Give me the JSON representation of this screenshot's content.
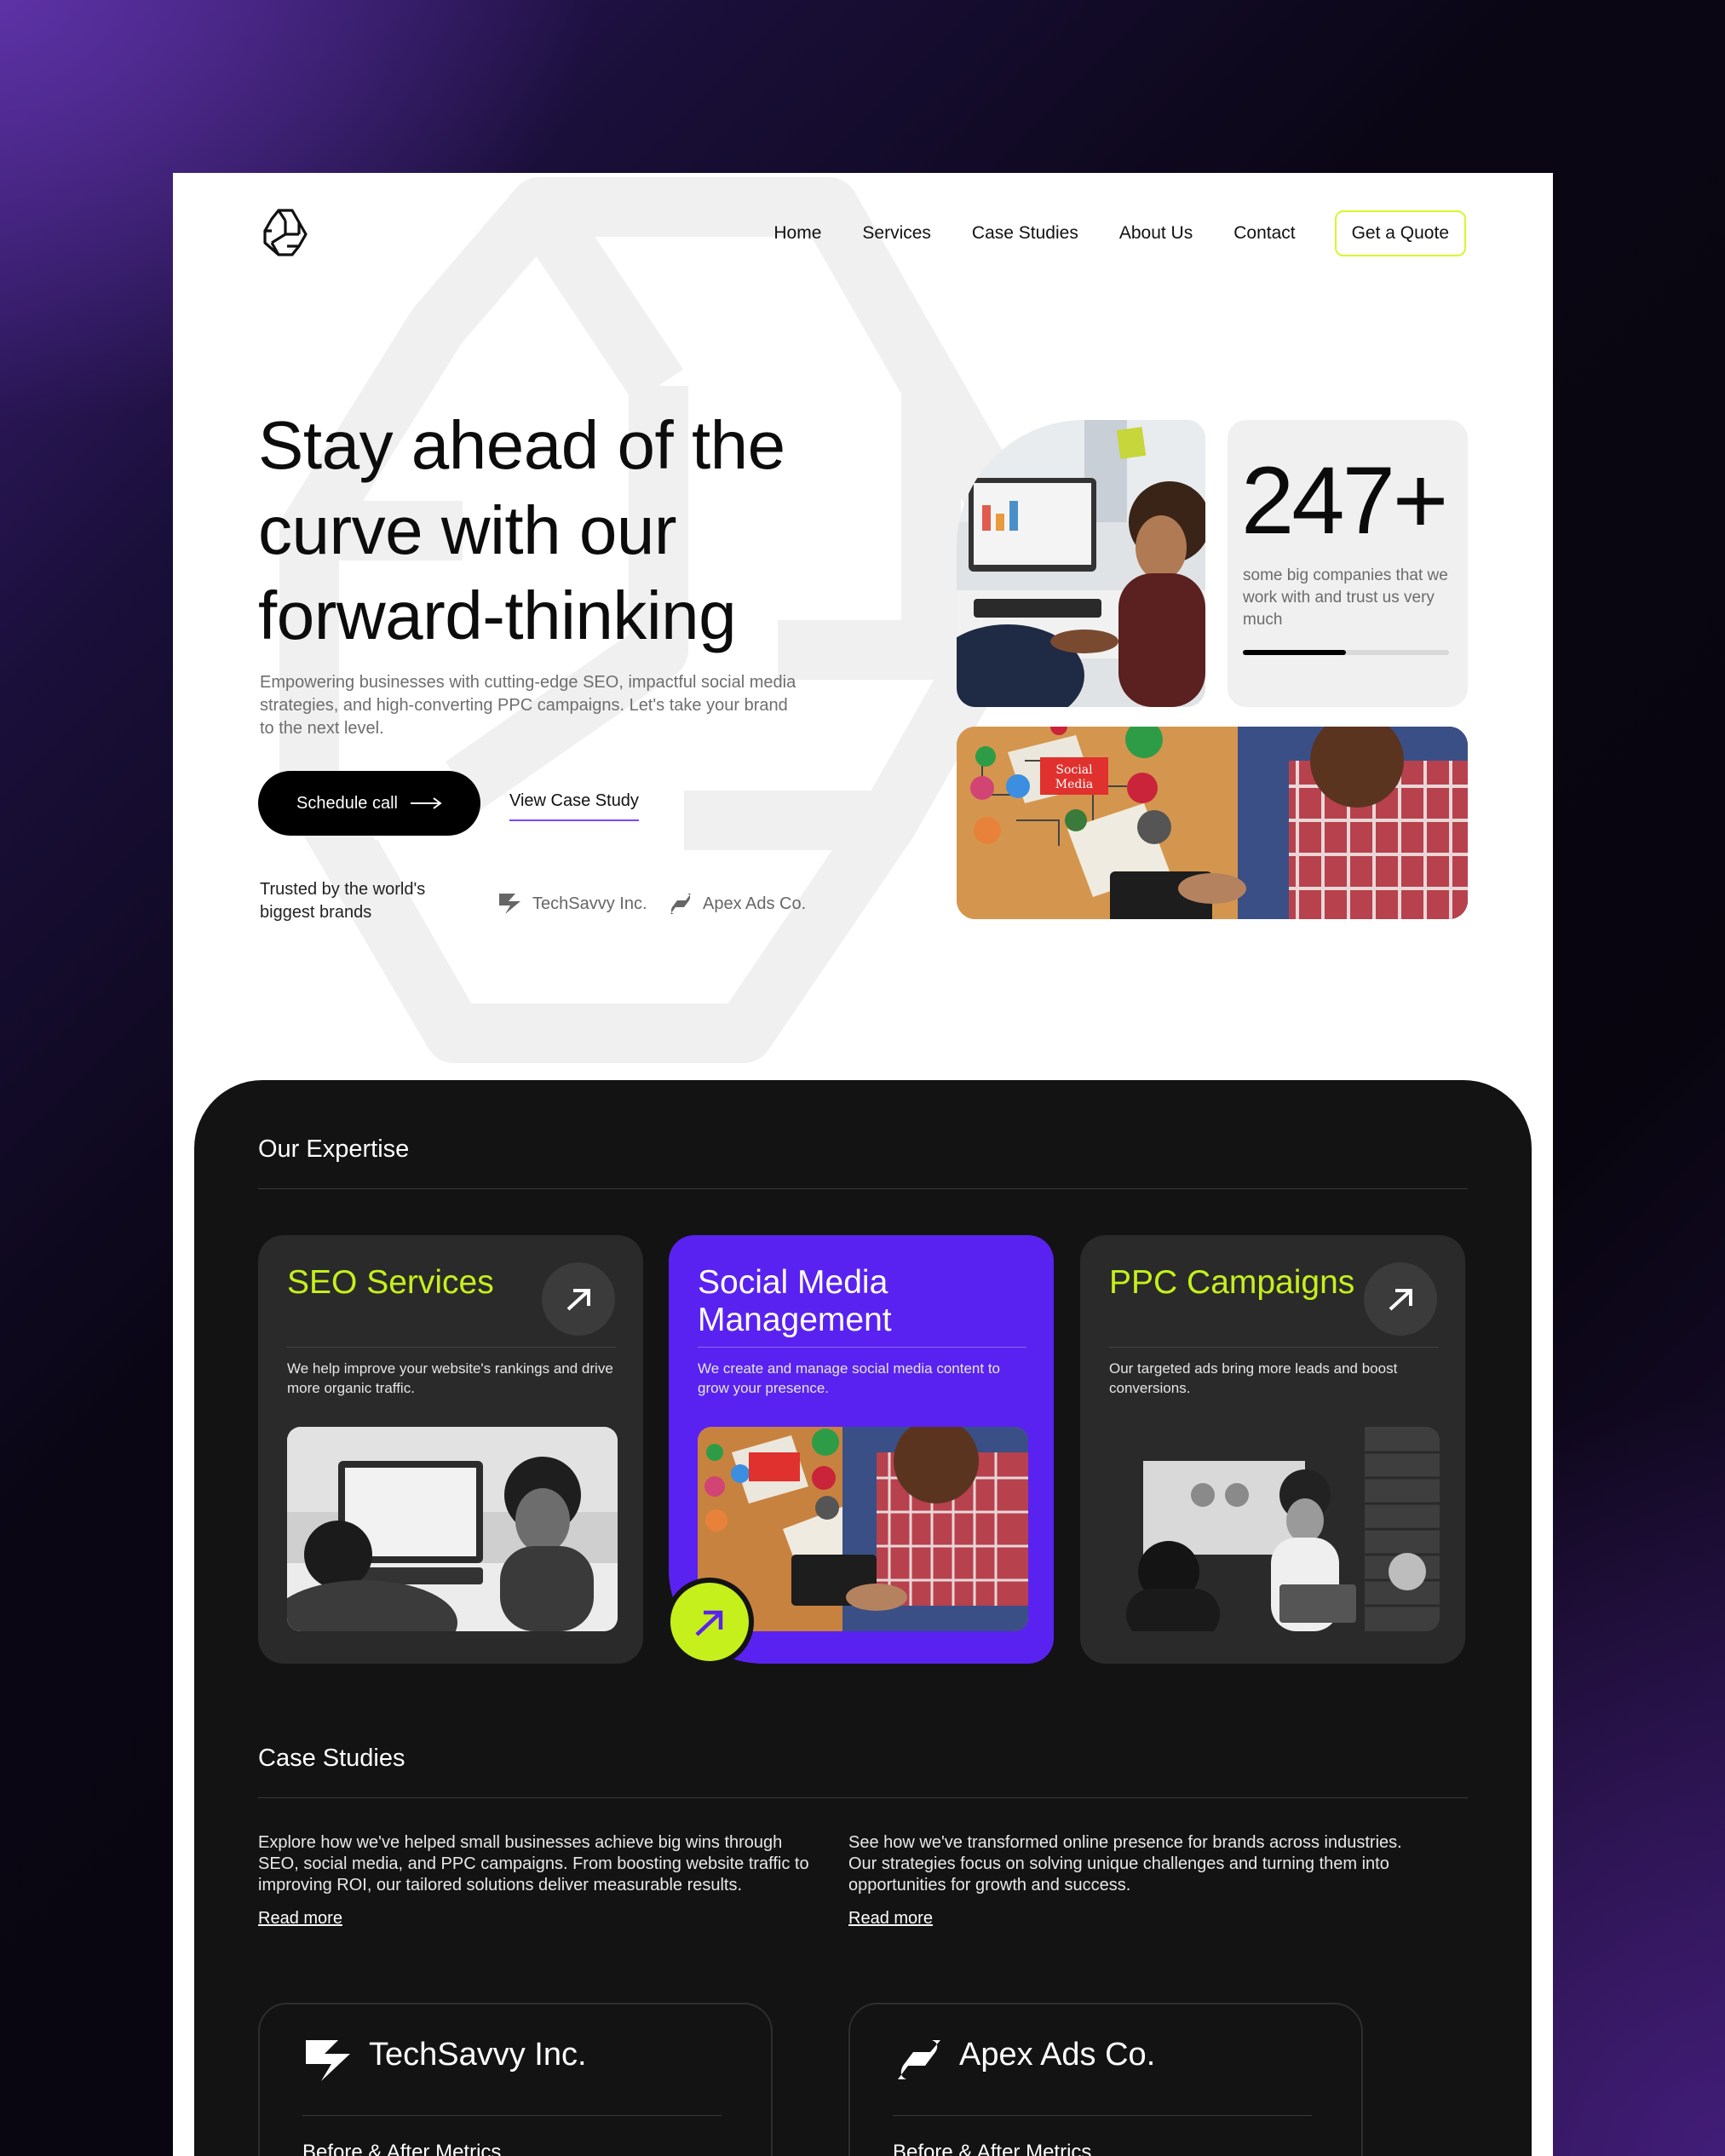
{
  "nav": {
    "items": [
      "Home",
      "Services",
      "Case Studies",
      "About Us",
      "Contact"
    ],
    "cta": "Get a Quote"
  },
  "hero": {
    "title": "Stay ahead of the curve with our forward-thinking",
    "subtitle": "Empowering businesses with cutting-edge SEO, impactful social media strategies, and high-converting PPC campaigns. Let's take your brand to the next level.",
    "primary_button": "Schedule call",
    "secondary_button": "View Case Study",
    "trusted_text": "Trusted by the world's biggest brands",
    "brands": [
      "TechSavvy Inc.",
      "Apex Ads Co."
    ],
    "stat_value": "247+",
    "stat_text": "some big companies that we work with and trust us very much",
    "stat_progress": 0.5,
    "social_tag": "Social Media"
  },
  "expertise": {
    "heading": "Our Expertise",
    "cards": [
      {
        "title": "SEO Services",
        "desc": "We help improve your website's rankings and drive more organic traffic."
      },
      {
        "title": "Social Media Management",
        "desc": "We create and manage social media content to grow your presence."
      },
      {
        "title": "PPC Campaigns",
        "desc": "Our targeted ads bring more leads and boost conversions."
      }
    ]
  },
  "case_studies": {
    "heading": "Case Studies",
    "items": [
      {
        "text": "Explore how we've helped small businesses achieve big wins through SEO, social media, and PPC campaigns. From boosting website traffic to improving ROI, our tailored solutions deliver measurable results.",
        "link": "Read more"
      },
      {
        "text": "See how we've transformed online presence for brands across industries. Our strategies focus on solving unique challenges and turning them into opportunities for growth and success.",
        "link": "Read more"
      }
    ],
    "clients": [
      {
        "name": "TechSavvy Inc.",
        "sub": "Before & After Metrics"
      },
      {
        "name": "Apex Ads Co.",
        "sub": "Before & After Metrics"
      }
    ]
  },
  "colors": {
    "accent_lime": "#c6f01b",
    "accent_purple": "#5a22f0",
    "dark_bg": "#131313",
    "card_bg": "#2a2a2a"
  }
}
